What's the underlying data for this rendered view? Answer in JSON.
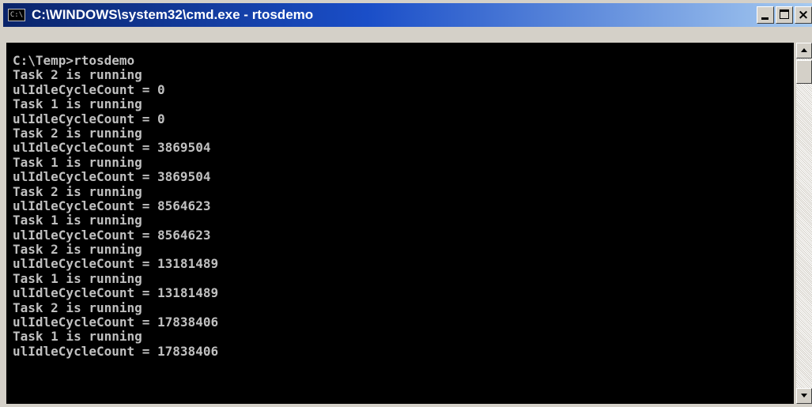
{
  "window": {
    "title": "C:\\WINDOWS\\system32\\cmd.exe - rtosdemo",
    "icon": "console-icon",
    "buttons": {
      "minimize": "minimize-icon",
      "maximize": "maximize-icon",
      "close": "close-icon"
    }
  },
  "console": {
    "lines": [
      "C:\\Temp>rtosdemo",
      "Task 2 is running",
      "ulIdleCycleCount = 0",
      "Task 1 is running",
      "ulIdleCycleCount = 0",
      "Task 2 is running",
      "ulIdleCycleCount = 3869504",
      "Task 1 is running",
      "ulIdleCycleCount = 3869504",
      "Task 2 is running",
      "ulIdleCycleCount = 8564623",
      "Task 1 is running",
      "ulIdleCycleCount = 8564623",
      "Task 2 is running",
      "ulIdleCycleCount = 13181489",
      "Task 1 is running",
      "ulIdleCycleCount = 13181489",
      "Task 2 is running",
      "ulIdleCycleCount = 17838406",
      "Task 1 is running",
      "ulIdleCycleCount = 17838406"
    ]
  },
  "colors": {
    "console_background": "#000000",
    "console_text": "#c0c0c0",
    "title_start": "#0a246a",
    "title_end": "#a6caf0"
  }
}
